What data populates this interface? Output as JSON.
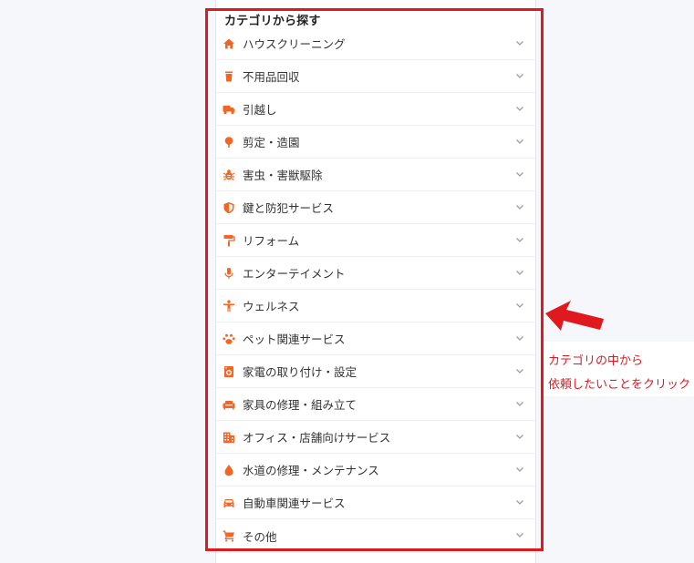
{
  "section": {
    "title": "カテゴリから探す"
  },
  "colors": {
    "accent": "#f26522",
    "annotation": "#e0191f"
  },
  "categories": [
    {
      "label": "ハウスクリーニング",
      "icon": "home-icon"
    },
    {
      "label": "不用品回収",
      "icon": "trash-icon"
    },
    {
      "label": "引越し",
      "icon": "truck-icon"
    },
    {
      "label": "剪定・造園",
      "icon": "tree-icon"
    },
    {
      "label": "害虫・害獣駆除",
      "icon": "bug-icon"
    },
    {
      "label": "鍵と防犯サービス",
      "icon": "shield-icon"
    },
    {
      "label": "リフォーム",
      "icon": "paint-roller-icon"
    },
    {
      "label": "エンターテイメント",
      "icon": "microphone-icon"
    },
    {
      "label": "ウェルネス",
      "icon": "person-icon"
    },
    {
      "label": "ペット関連サービス",
      "icon": "paw-icon"
    },
    {
      "label": "家電の取り付け・設定",
      "icon": "washing-machine-icon"
    },
    {
      "label": "家具の修理・組み立て",
      "icon": "sofa-icon"
    },
    {
      "label": "オフィス・店舗向けサービス",
      "icon": "building-icon"
    },
    {
      "label": "水道の修理・メンテナンス",
      "icon": "water-drop-icon"
    },
    {
      "label": "自動車関連サービス",
      "icon": "car-icon"
    },
    {
      "label": "その他",
      "icon": "cart-icon"
    }
  ],
  "annotation": {
    "line1": "カテゴリの中から",
    "line2": "依頼したいことをクリック"
  }
}
